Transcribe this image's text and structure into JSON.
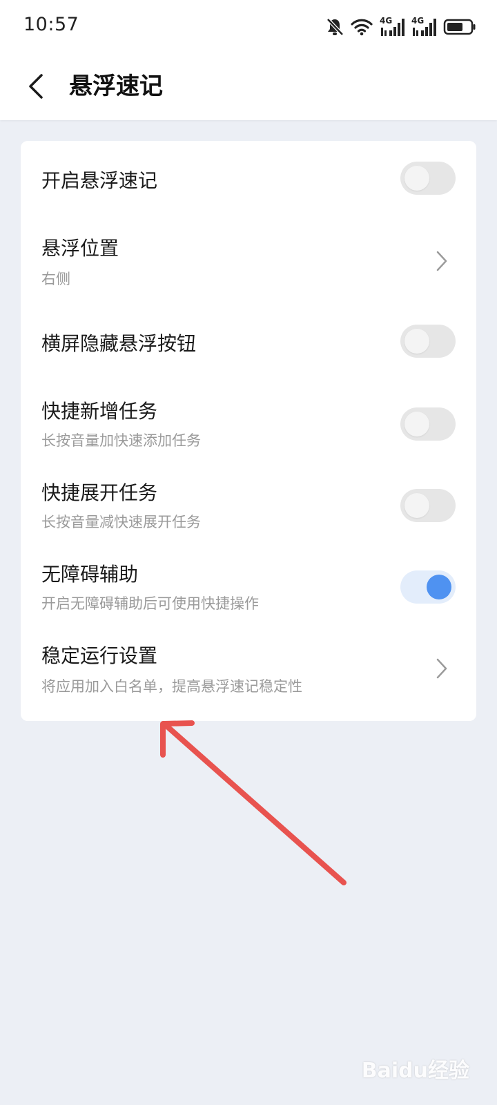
{
  "status_bar": {
    "time": "10:57",
    "icons": [
      "bell-muted-icon",
      "wifi-icon",
      "signal-4g-icon",
      "signal-4g-icon",
      "battery-icon"
    ],
    "network_label_1": "4G",
    "network_label_2": "4G"
  },
  "header": {
    "back_icon": "chevron-left-icon",
    "title": "悬浮速记"
  },
  "settings": [
    {
      "title": "开启悬浮速记",
      "subtitle": "",
      "control": "toggle",
      "checked": false
    },
    {
      "title": "悬浮位置",
      "subtitle": "右侧",
      "control": "chevron"
    },
    {
      "title": "横屏隐藏悬浮按钮",
      "subtitle": "",
      "control": "toggle",
      "checked": false
    },
    {
      "title": "快捷新增任务",
      "subtitle": "长按音量加快速添加任务",
      "control": "toggle",
      "checked": false
    },
    {
      "title": "快捷展开任务",
      "subtitle": "长按音量减快速展开任务",
      "control": "toggle",
      "checked": false
    },
    {
      "title": "无障碍辅助",
      "subtitle": "开启无障碍辅助后可使用快捷操作",
      "control": "toggle",
      "checked": true
    },
    {
      "title": "稳定运行设置",
      "subtitle": "将应用加入白名单，提高悬浮速记稳定性",
      "control": "chevron"
    }
  ],
  "colors": {
    "background": "#eceff5",
    "card": "#ffffff",
    "accent": "#4f92f1",
    "toggle_on_track": "#e3edfb",
    "toggle_off_track": "#e6e6e6",
    "annotation_arrow": "#e8534f"
  },
  "watermark": "Baidu经验"
}
